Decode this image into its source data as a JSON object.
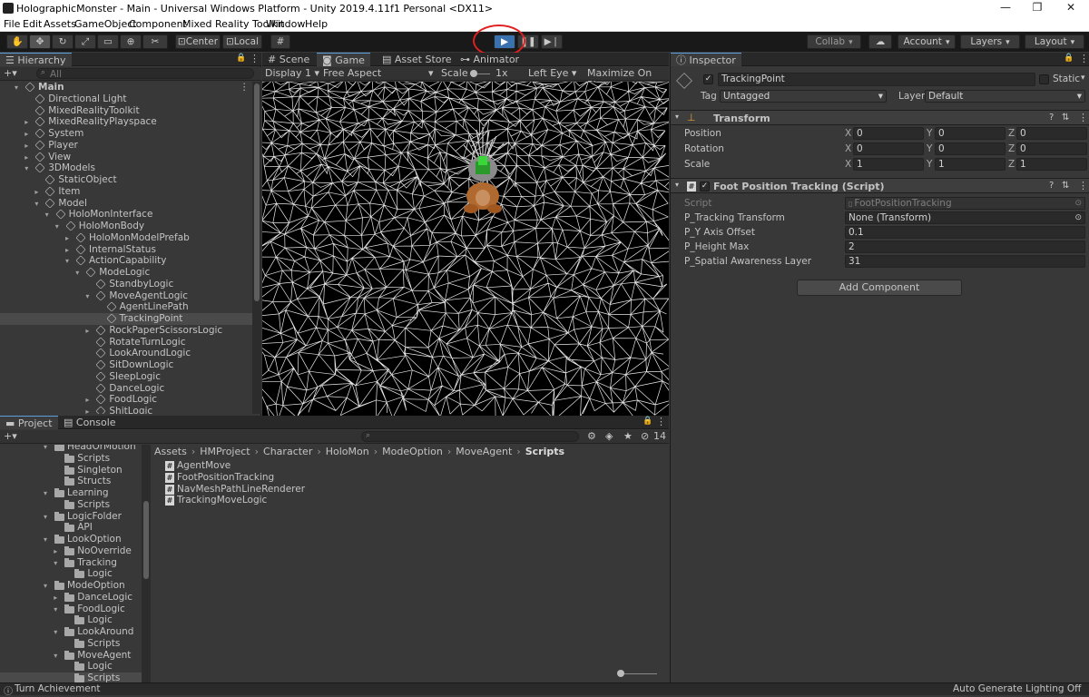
{
  "window": {
    "title": "HolographicMonster - Main - Universal Windows Platform - Unity 2019.4.11f1 Personal <DX11>"
  },
  "menu": [
    "File",
    "Edit",
    "Assets",
    "GameObject",
    "Component",
    "Mixed Reality Toolkit",
    "Window",
    "Help"
  ],
  "toolbar": {
    "center_label": "Center",
    "local_label": "Local",
    "collab_label": "Collab",
    "account_label": "Account",
    "layers_label": "Layers",
    "layout_label": "Layout"
  },
  "hierarchy": {
    "tab": "Hierarchy",
    "add": "+▾",
    "search_placeholder": "All",
    "items": [
      {
        "label": "Main",
        "depth": 0,
        "arrow": "▾"
      },
      {
        "label": "Directional Light",
        "depth": 1,
        "arrow": ""
      },
      {
        "label": "MixedRealityToolkit",
        "depth": 1,
        "arrow": ""
      },
      {
        "label": "MixedRealityPlayspace",
        "depth": 1,
        "arrow": "▸"
      },
      {
        "label": "System",
        "depth": 1,
        "arrow": "▸"
      },
      {
        "label": "Player",
        "depth": 1,
        "arrow": "▸"
      },
      {
        "label": "View",
        "depth": 1,
        "arrow": "▸"
      },
      {
        "label": "3DModels",
        "depth": 1,
        "arrow": "▾"
      },
      {
        "label": "StaticObject",
        "depth": 2,
        "arrow": ""
      },
      {
        "label": "Item",
        "depth": 2,
        "arrow": "▸"
      },
      {
        "label": "Model",
        "depth": 2,
        "arrow": "▾"
      },
      {
        "label": "HoloMonInterface",
        "depth": 3,
        "arrow": "▾"
      },
      {
        "label": "HoloMonBody",
        "depth": 4,
        "arrow": "▾"
      },
      {
        "label": "HoloMonModelPrefab",
        "depth": 5,
        "arrow": "▸"
      },
      {
        "label": "InternalStatus",
        "depth": 5,
        "arrow": "▸"
      },
      {
        "label": "ActionCapability",
        "depth": 5,
        "arrow": "▾"
      },
      {
        "label": "ModeLogic",
        "depth": 6,
        "arrow": "▾"
      },
      {
        "label": "StandbyLogic",
        "depth": 7,
        "arrow": ""
      },
      {
        "label": "MoveAgentLogic",
        "depth": 7,
        "arrow": "▾"
      },
      {
        "label": "AgentLinePath",
        "depth": 8,
        "arrow": ""
      },
      {
        "label": "TrackingPoint",
        "depth": 8,
        "arrow": "",
        "selected": true
      },
      {
        "label": "RockPaperScissorsLogic",
        "depth": 7,
        "arrow": "▸"
      },
      {
        "label": "RotateTurnLogic",
        "depth": 7,
        "arrow": ""
      },
      {
        "label": "LookAroundLogic",
        "depth": 7,
        "arrow": ""
      },
      {
        "label": "SitDownLogic",
        "depth": 7,
        "arrow": ""
      },
      {
        "label": "SleepLogic",
        "depth": 7,
        "arrow": ""
      },
      {
        "label": "DanceLogic",
        "depth": 7,
        "arrow": ""
      },
      {
        "label": "FoodLogic",
        "depth": 7,
        "arrow": "▸"
      },
      {
        "label": "ShitLogic",
        "depth": 7,
        "arrow": "▸"
      }
    ]
  },
  "sceneview": {
    "tabs": [
      "Scene",
      "Game",
      "Asset Store",
      "Animator"
    ],
    "display": "Display 1",
    "aspect": "Free Aspect",
    "scale_label": "Scale",
    "scale_value": "1x",
    "eye": "Left Eye",
    "maximize": "Maximize On Play"
  },
  "inspector": {
    "tab": "Inspector",
    "object_name": "TrackingPoint",
    "static_label": "Static",
    "tag_label": "Tag",
    "tag_value": "Untagged",
    "layer_label": "Layer",
    "layer_value": "Default",
    "transform": {
      "title": "Transform",
      "rows": [
        {
          "label": "Position",
          "x": "0",
          "y": "0",
          "z": "0"
        },
        {
          "label": "Rotation",
          "x": "0",
          "y": "0",
          "z": "0"
        },
        {
          "label": "Scale",
          "x": "1",
          "y": "1",
          "z": "1"
        }
      ]
    },
    "component": {
      "title": "Foot Position Tracking (Script)",
      "rows": [
        {
          "label": "Script",
          "value": "FootPositionTracking"
        },
        {
          "label": "P_Tracking Transform",
          "value": "None (Transform)"
        },
        {
          "label": "P_Y Axis Offset",
          "value": "0.1"
        },
        {
          "label": "P_Height Max",
          "value": "2"
        },
        {
          "label": "P_Spatial Awareness Layer",
          "value": "31"
        }
      ]
    },
    "add_component": "Add Component"
  },
  "project": {
    "tabs": [
      "Project",
      "Console"
    ],
    "add": "+▾",
    "hidden_count": "14",
    "breadcrumb": [
      "Assets",
      "HMProject",
      "Character",
      "HoloMon",
      "ModeOption",
      "MoveAgent",
      "Scripts"
    ],
    "tree": [
      {
        "label": "HeadOrMotion",
        "depth": 1,
        "arrow": "▾",
        "partial": true
      },
      {
        "label": "Scripts",
        "depth": 2,
        "arrow": ""
      },
      {
        "label": "Singleton",
        "depth": 2,
        "arrow": ""
      },
      {
        "label": "Structs",
        "depth": 2,
        "arrow": ""
      },
      {
        "label": "Learning",
        "depth": 1,
        "arrow": "▾"
      },
      {
        "label": "Scripts",
        "depth": 2,
        "arrow": ""
      },
      {
        "label": "LogicFolder",
        "depth": 1,
        "arrow": "▾"
      },
      {
        "label": "API",
        "depth": 2,
        "arrow": ""
      },
      {
        "label": "LookOption",
        "depth": 1,
        "arrow": "▾"
      },
      {
        "label": "NoOverride",
        "depth": 2,
        "arrow": "▸"
      },
      {
        "label": "Tracking",
        "depth": 2,
        "arrow": "▾"
      },
      {
        "label": "Logic",
        "depth": 3,
        "arrow": ""
      },
      {
        "label": "ModeOption",
        "depth": 1,
        "arrow": "▾"
      },
      {
        "label": "DanceLogic",
        "depth": 2,
        "arrow": "▸"
      },
      {
        "label": "FoodLogic",
        "depth": 2,
        "arrow": "▾"
      },
      {
        "label": "Logic",
        "depth": 3,
        "arrow": ""
      },
      {
        "label": "LookAround",
        "depth": 2,
        "arrow": "▾"
      },
      {
        "label": "Scripts",
        "depth": 3,
        "arrow": ""
      },
      {
        "label": "MoveAgent",
        "depth": 2,
        "arrow": "▾"
      },
      {
        "label": "Logic",
        "depth": 3,
        "arrow": ""
      },
      {
        "label": "Scripts",
        "depth": 3,
        "arrow": "",
        "selected": true
      }
    ],
    "files": [
      "AgentMove",
      "FootPositionTracking",
      "NavMeshPathLineRenderer",
      "TrackingMoveLogic"
    ]
  },
  "status": {
    "left": "Turn Achievement",
    "right": "Auto Generate Lighting Off"
  },
  "colors": {
    "accent": "#3a72b0",
    "highlight": "#e02020",
    "selected": "#4a4a4a"
  }
}
